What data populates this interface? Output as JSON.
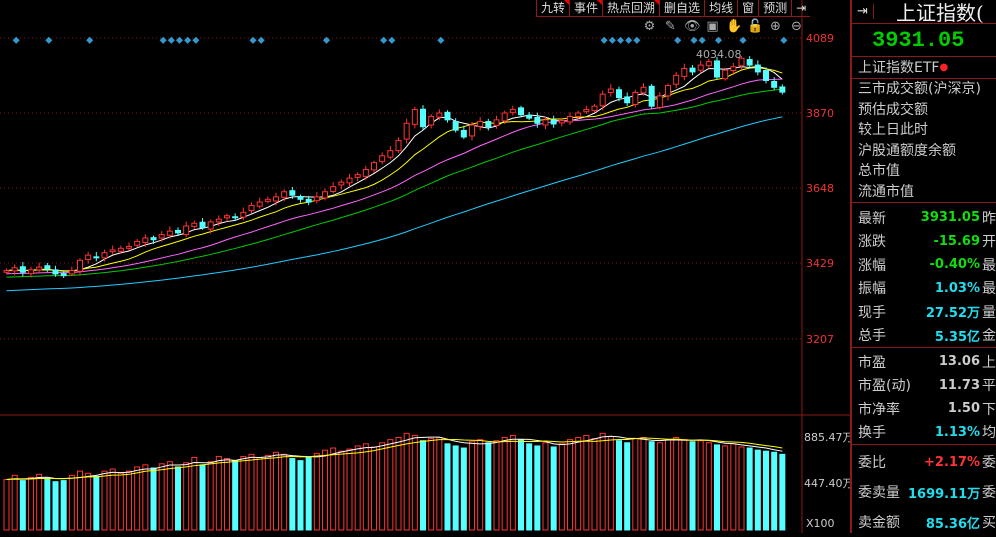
{
  "toolbar": {
    "items": [
      "九转",
      "事件",
      "热点回溯",
      "删自选",
      "均线",
      "窗",
      "预测"
    ],
    "exit": "⇥"
  },
  "tools": [
    "⚙",
    "✎",
    "👁",
    "▣",
    "✋",
    "🔓",
    "⊕",
    "⊖"
  ],
  "price_axis": [
    "4089",
    "3870",
    "3648",
    "3429",
    "3207"
  ],
  "volume_axis": [
    "885.47万",
    "447.40万",
    "X100"
  ],
  "high_label": "4034.08",
  "right": {
    "title": "上证指数(",
    "price": "3931.05",
    "etf": "上证指数ETF",
    "labels": [
      "三市成交额(沪深京)",
      "预估成交额",
      "较上日此时",
      "沪股通额度余额",
      "总市值",
      "流通市值"
    ],
    "quote": [
      {
        "k": "最新",
        "v": "3931.05",
        "s": "昨",
        "c": "g"
      },
      {
        "k": "涨跌",
        "v": "-15.69",
        "s": "开",
        "c": "g"
      },
      {
        "k": "涨幅",
        "v": "-0.40%",
        "s": "最",
        "c": "g"
      },
      {
        "k": "振幅",
        "v": "1.03%",
        "s": "最",
        "c": "c"
      },
      {
        "k": "现手",
        "v": "27.52万",
        "s": "量",
        "c": "c"
      },
      {
        "k": "总手",
        "v": "5.35亿",
        "s": "金",
        "c": "c"
      }
    ],
    "valuation": [
      {
        "k": "市盈",
        "v": "13.06",
        "s": "上",
        "c": "w"
      },
      {
        "k": "市盈(动)",
        "v": "11.73",
        "s": "平",
        "c": "w"
      },
      {
        "k": "市净率",
        "v": "1.50",
        "s": "下",
        "c": "w"
      },
      {
        "k": "换手",
        "v": "1.13%",
        "s": "均",
        "c": "c"
      }
    ],
    "orders": [
      {
        "k": "委比",
        "v": "+2.17%",
        "s": "委",
        "c": "r"
      },
      {
        "k": "委卖量",
        "v": "1699.11万",
        "s": "委",
        "c": "c"
      },
      {
        "k": "卖金额",
        "v": "85.36亿",
        "s": "买",
        "c": "c"
      }
    ]
  },
  "chart_data": {
    "type": "candlestick",
    "price_range": [
      3100,
      4140
    ],
    "volume_max": 1000,
    "closes": [
      3410,
      3418,
      3405,
      3412,
      3420,
      3415,
      3400,
      3395,
      3410,
      3440,
      3455,
      3448,
      3462,
      3470,
      3475,
      3480,
      3495,
      3505,
      3500,
      3515,
      3525,
      3520,
      3540,
      3548,
      3535,
      3552,
      3560,
      3570,
      3565,
      3580,
      3600,
      3610,
      3618,
      3625,
      3640,
      3630,
      3618,
      3610,
      3625,
      3640,
      3655,
      3668,
      3680,
      3690,
      3705,
      3725,
      3745,
      3760,
      3790,
      3840,
      3880,
      3830,
      3860,
      3870,
      3850,
      3820,
      3800,
      3835,
      3845,
      3830,
      3850,
      3870,
      3880,
      3865,
      3855,
      3840,
      3850,
      3838,
      3848,
      3860,
      3870,
      3880,
      3890,
      3925,
      3940,
      3915,
      3900,
      3930,
      3945,
      3890,
      3920,
      3950,
      3980,
      4000,
      3990,
      4010,
      4020,
      3975,
      3995,
      4005,
      4030,
      4010,
      3990,
      3965,
      3945,
      3931
    ],
    "volumes": [
      480,
      520,
      470,
      500,
      530,
      490,
      460,
      470,
      520,
      560,
      540,
      510,
      560,
      580,
      540,
      560,
      600,
      620,
      590,
      630,
      650,
      600,
      640,
      690,
      620,
      650,
      700,
      680,
      660,
      700,
      720,
      690,
      710,
      740,
      720,
      680,
      660,
      690,
      730,
      760,
      780,
      750,
      770,
      800,
      820,
      790,
      830,
      860,
      880,
      920,
      900,
      850,
      870,
      880,
      820,
      800,
      780,
      840,
      860,
      830,
      850,
      880,
      900,
      860,
      820,
      800,
      830,
      790,
      820,
      860,
      880,
      900,
      870,
      920,
      890,
      850,
      830,
      870,
      880,
      840,
      830,
      860,
      880,
      860,
      840,
      850,
      830,
      810,
      800,
      820,
      790,
      780,
      760,
      750,
      740,
      720
    ]
  }
}
